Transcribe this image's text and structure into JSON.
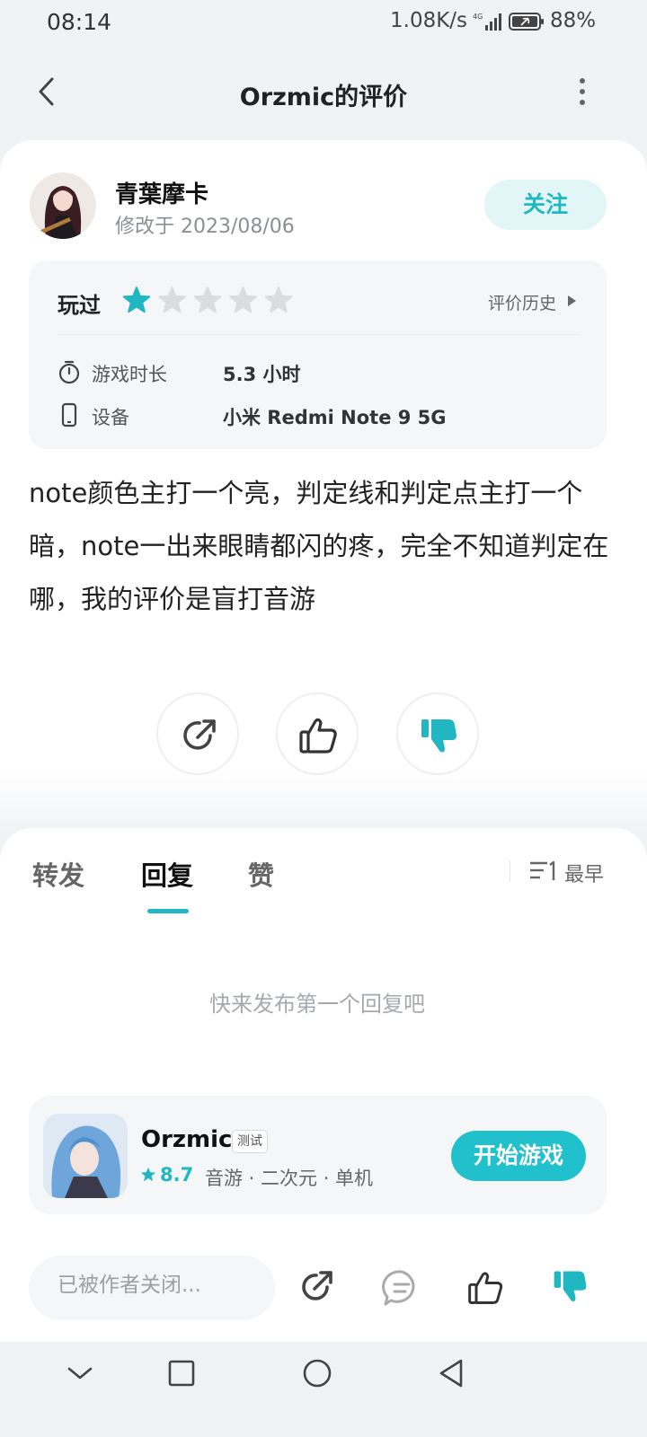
{
  "status_bar": {
    "time": "08:14",
    "net_speed": "1.08K/s",
    "network": "4G",
    "battery": "88%"
  },
  "header": {
    "title": "Orzmic的评价",
    "back_icon": "chevron-left-icon",
    "more_icon": "more-vertical-icon"
  },
  "review": {
    "author": "青葉摩卡",
    "modified": "修改于 2023/08/06",
    "follow_label": "关注",
    "status": "玩过",
    "rating": 1,
    "rating_max": 5,
    "history_label": "评价历史",
    "play_time_label": "游戏时长",
    "play_time_value": "5.3 小时",
    "device_label": "设备",
    "device_value": "小米 Redmi Note 9 5G",
    "body": "note颜色主打一个亮，判定线和判定点主打一个暗，note一出来眼睛都闪的疼，完全不知道判定在哪，我的评价是盲打音游"
  },
  "tabs": {
    "forward": "转发",
    "reply": "回复",
    "like": "赞",
    "active": "回复"
  },
  "sort": {
    "label": "最早"
  },
  "replies": {
    "empty_text": "快来发布第一个回复吧"
  },
  "game": {
    "name": "Orzmic",
    "badge": "测试",
    "score": "8.7",
    "tags": [
      "音游",
      "二次元",
      "单机"
    ],
    "tags_text": "音游 · 二次元 · 单机",
    "start_label": "开始游戏"
  },
  "bottom_bar": {
    "input_placeholder": "已被作者关闭..."
  },
  "colors": {
    "accent": "#20c1cd",
    "star_filled": "#20b7c3",
    "star_empty": "#d9dde0",
    "background": "#f0f2f4"
  }
}
